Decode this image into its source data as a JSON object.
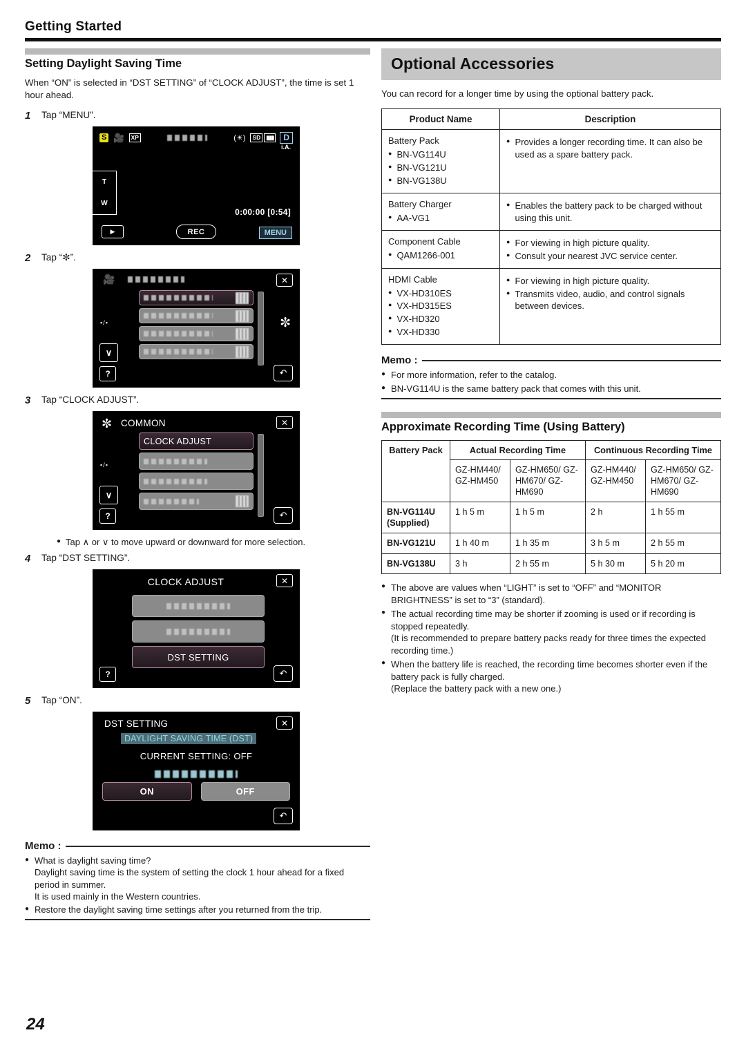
{
  "running_head": {
    "title": "Getting Started"
  },
  "page_number": "24",
  "left": {
    "section_title": "Setting Daylight Saving Time",
    "intro": "When “ON” is selected in “DST SETTING” of “CLOCK ADJUST”, the time is set 1 hour ahead.",
    "steps": [
      {
        "num": "1",
        "text": "Tap “MENU”."
      },
      {
        "num": "2",
        "text": "Tap “✼”."
      },
      {
        "num": "3",
        "text": "Tap “CLOCK ADJUST”."
      },
      {
        "num": "4",
        "text": "Tap “DST SETTING”."
      },
      {
        "num": "5",
        "text": "Tap “ON”."
      }
    ],
    "sub_bullet": "Tap ∧ or ∨ to move upward or downward for more selection.",
    "screens": {
      "record": {
        "mode_badge": "S",
        "quality_badge": "XP",
        "sd_badge": "SD",
        "d_badge": "D",
        "ia_label": "i.A.",
        "zoom_tele": "T",
        "zoom_wide": "W",
        "timecode": "0:00:00  [0:54]",
        "play_button": "▶",
        "rec_button": "REC",
        "menu_button": "MENU"
      },
      "menu": {
        "close": "✕",
        "gear": "✼",
        "back": "↶",
        "help": "?",
        "updown": "▪/▪",
        "down": "∨"
      },
      "common": {
        "title": "COMMON",
        "selected_item": "CLOCK ADJUST"
      },
      "clock_adjust": {
        "title": "CLOCK ADJUST",
        "selected_item": "DST SETTING"
      },
      "dst": {
        "title": "DST SETTING",
        "highlight": "DAYLIGHT SAVING TIME (DST)",
        "current": "CURRENT SETTING: OFF",
        "on_label": "ON",
        "off_label": "OFF"
      }
    },
    "memo": {
      "label": "Memo :",
      "items": [
        {
          "text": "What is daylight saving time?",
          "sub": [
            "Daylight saving time is the system of setting the clock 1 hour ahead for a fixed period in summer.",
            "It is used mainly in the Western countries."
          ]
        },
        {
          "text": "Restore the daylight saving time settings after you returned from the trip.",
          "sub": []
        }
      ]
    }
  },
  "right": {
    "banner_title": "Optional Accessories",
    "intro": "You can record for a longer time by using the optional battery pack.",
    "accessories_table": {
      "headers": [
        "Product Name",
        "Description"
      ],
      "rows": [
        {
          "name": "Battery Pack",
          "models": [
            "BN-VG114U",
            "BN-VG121U",
            "BN-VG138U"
          ],
          "desc": [
            "Provides a longer recording time. It can also be used as a spare battery pack."
          ]
        },
        {
          "name": "Battery Charger",
          "models": [
            "AA-VG1"
          ],
          "desc": [
            "Enables the battery pack to be charged without using this unit."
          ]
        },
        {
          "name": "Component Cable",
          "models": [
            "QAM1266-001"
          ],
          "desc": [
            "For viewing in high picture quality.",
            "Consult your nearest JVC service center."
          ]
        },
        {
          "name": "HDMI Cable",
          "models": [
            "VX-HD310ES",
            "VX-HD315ES",
            "VX-HD320",
            "VX-HD330"
          ],
          "desc": [
            "For viewing in high picture quality.",
            "Transmits video, audio, and control signals between devices."
          ]
        }
      ]
    },
    "memo": {
      "label": "Memo :",
      "items": [
        "For more information, refer to the catalog.",
        "BN-VG114U is the same battery pack that comes with this unit."
      ]
    },
    "recording_section_title": "Approximate Recording Time (Using Battery)",
    "recording_table": {
      "col_battery": "Battery Pack",
      "group_headers": [
        "Actual Recording Time",
        "Continuous Recording Time"
      ],
      "sub_headers": [
        "GZ-HM440/ GZ-HM450",
        "GZ-HM650/ GZ-HM670/ GZ-HM690",
        "GZ-HM440/ GZ-HM450",
        "GZ-HM650/ GZ-HM670/ GZ-HM690"
      ],
      "rows": [
        {
          "pack": "BN-VG114U (Supplied)",
          "values": [
            "1 h 5 m",
            "1 h 5 m",
            "2 h",
            "1 h 55 m"
          ]
        },
        {
          "pack": "BN-VG121U",
          "values": [
            "1 h 40 m",
            "1 h 35 m",
            "3 h 5 m",
            "2 h 55 m"
          ]
        },
        {
          "pack": "BN-VG138U",
          "values": [
            "3 h",
            "2 h 55 m",
            "5 h 30 m",
            "5 h 20 m"
          ]
        }
      ]
    },
    "notes": [
      "The above are values when “LIGHT” is set to “OFF” and “MONITOR BRIGHTNESS” is set to “3” (standard).",
      "The actual recording time may be shorter if zooming is used or if recording is stopped repeatedly.\n(It is recommended to prepare battery packs ready for three times the expected recording time.)",
      "When the battery life is reached, the recording time becomes shorter even if the battery pack is fully charged.\n(Replace the battery pack with a new one.)"
    ]
  }
}
